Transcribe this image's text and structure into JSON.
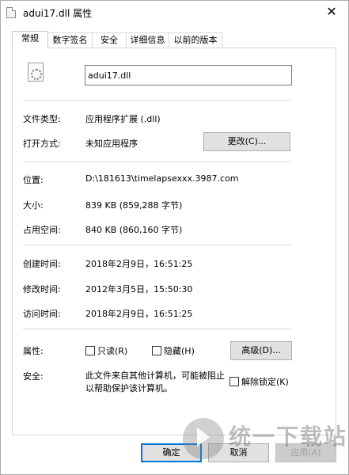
{
  "window": {
    "title": "adui17.dll 属性",
    "close_glyph": "✕"
  },
  "tabs": [
    {
      "label": "常规",
      "active": true
    },
    {
      "label": "数字签名",
      "active": false
    },
    {
      "label": "安全",
      "active": false
    },
    {
      "label": "详细信息",
      "active": false
    },
    {
      "label": "以前的版本",
      "active": false
    }
  ],
  "general": {
    "file_name": "adui17.dll",
    "file_type_label": "文件类型:",
    "file_type_value": "应用程序扩展 (.dll)",
    "open_with_label": "打开方式:",
    "open_with_value": "未知应用程序",
    "change_button": "更改(C)...",
    "location_label": "位置:",
    "location_value": "D:\\181613\\timelapsexxx.3987.com",
    "size_label": "大小:",
    "size_value": "839 KB (859,288 字节)",
    "size_on_disk_label": "占用空间:",
    "size_on_disk_value": "840 KB (860,160 字节)",
    "created_label": "创建时间:",
    "created_value": "2018年2月9日，16:51:25",
    "modified_label": "修改时间:",
    "modified_value": "2012年3月5日，15:50:30",
    "accessed_label": "访问时间:",
    "accessed_value": "2018年2月9日，16:51:25",
    "attributes_label": "属性:",
    "readonly_label": "只读(R)",
    "readonly_checked": false,
    "hidden_label": "隐藏(H)",
    "hidden_checked": false,
    "advanced_button": "高级(D)...",
    "security_label": "安全:",
    "security_text": "此文件来自其他计算机，可能被阻止以帮助保护该计算机。",
    "unblock_label": "解除锁定(K)",
    "unblock_checked": false
  },
  "footer": {
    "ok_button": "确定",
    "cancel_button": "取消",
    "apply_button": "应用(A)"
  },
  "watermark": {
    "text": "统一下载站"
  },
  "colors": {
    "accent": "#0078d7",
    "border": "#d9d9d9",
    "button_bg": "#e1e1e1"
  },
  "icons": {
    "title": "dll-file-icon",
    "file": "dll-gear-file-icon",
    "close": "close-icon"
  }
}
